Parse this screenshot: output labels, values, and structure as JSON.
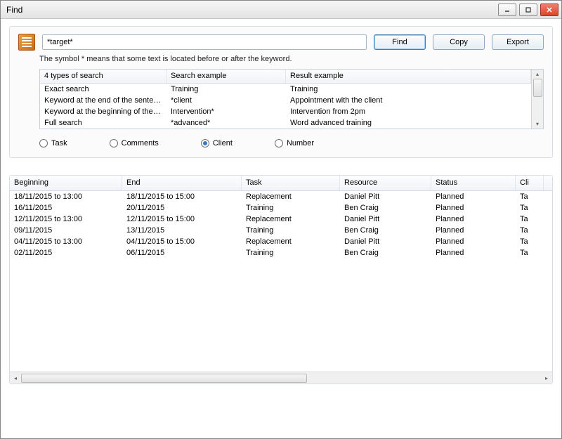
{
  "window": {
    "title": "Find"
  },
  "search": {
    "value": "*target*",
    "hint": "The symbol * means that some text is located before or after the keyword.",
    "find_label": "Find",
    "copy_label": "Copy",
    "export_label": "Export"
  },
  "example": {
    "headers": [
      "4 types of search",
      "Search example",
      "Result example"
    ],
    "rows": [
      {
        "type": "Exact search",
        "example": "Training",
        "result": "Training"
      },
      {
        "type": "Keyword at the end of the senten...",
        "example": "*client",
        "result": "Appointment with the client"
      },
      {
        "type": "Keyword at the beginning of the s...",
        "example": "Intervention*",
        "result": "Intervention from 2pm"
      },
      {
        "type": "Full search",
        "example": "*advanced*",
        "result": "Word advanced training"
      }
    ]
  },
  "radios": {
    "task": "Task",
    "comments": "Comments",
    "client": "Client",
    "number": "Number",
    "selected": "client"
  },
  "results": {
    "headers": [
      "Beginning",
      "End",
      "Task",
      "Resource",
      "Status",
      "Cli"
    ],
    "rows": [
      {
        "beginning": "18/11/2015 to 13:00",
        "end": "18/11/2015 to 15:00",
        "task": "Replacement",
        "resource": "Daniel Pitt",
        "status": "Planned",
        "client": "Ta"
      },
      {
        "beginning": "16/11/2015",
        "end": "20/11/2015",
        "task": "Training",
        "resource": "Ben Craig",
        "status": "Planned",
        "client": "Ta"
      },
      {
        "beginning": "12/11/2015 to 13:00",
        "end": "12/11/2015 to 15:00",
        "task": "Replacement",
        "resource": "Daniel Pitt",
        "status": "Planned",
        "client": "Ta"
      },
      {
        "beginning": "09/11/2015",
        "end": "13/11/2015",
        "task": "Training",
        "resource": "Ben Craig",
        "status": "Planned",
        "client": "Ta"
      },
      {
        "beginning": "04/11/2015 to 13:00",
        "end": "04/11/2015 to 15:00",
        "task": "Replacement",
        "resource": "Daniel Pitt",
        "status": "Planned",
        "client": "Ta"
      },
      {
        "beginning": "02/11/2015",
        "end": "06/11/2015",
        "task": "Training",
        "resource": "Ben Craig",
        "status": "Planned",
        "client": "Ta"
      }
    ]
  }
}
